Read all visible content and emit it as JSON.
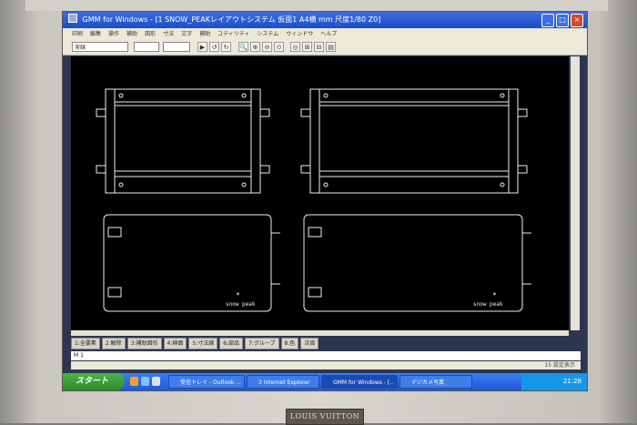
{
  "window": {
    "title": "GMM for Windows - [1 SNOW_PEAKレイアウトシステム 仮面1 A4横 mm 尺度1/80 Z0]"
  },
  "menu": [
    "印刷",
    "編集",
    "操作",
    "補助",
    "図形",
    "寸法",
    "文字",
    "補助",
    "ユティリティ",
    "システム",
    "ウィンドウ",
    "ヘルプ"
  ],
  "toolbar": {
    "layer_select": "実線",
    "buttons": [
      "▶",
      "↺",
      "↻",
      "🔍",
      "⊕",
      "⊖",
      "⊙",
      "◎",
      "⊞",
      "⊟",
      "▤"
    ]
  },
  "function_keys": [
    "1:全要素",
    "2:解除",
    "3:補助図形",
    "4:検面",
    "5:寸法線",
    "6:部品",
    "7:グループ",
    "8:色",
    "次頁"
  ],
  "command_line": "M 1",
  "status": {
    "left": "",
    "right": "15 設定表示"
  },
  "drawing": {
    "logo_text_1": "snow peak",
    "logo_text_2": "snow peak"
  },
  "taskbar": {
    "start": "スタート",
    "items": [
      "受信トレイ - Outlook ...",
      "3 Internet Explorer",
      "GMM for Windows - [..",
      "デジカメ写真"
    ],
    "clock": "21:28"
  },
  "brand": "LOUIS VUITTON",
  "colors": {
    "canvas": "#000000",
    "lines": "#e8eef4",
    "titlebar": "#2358d0",
    "taskbar": "#2a66e2"
  }
}
